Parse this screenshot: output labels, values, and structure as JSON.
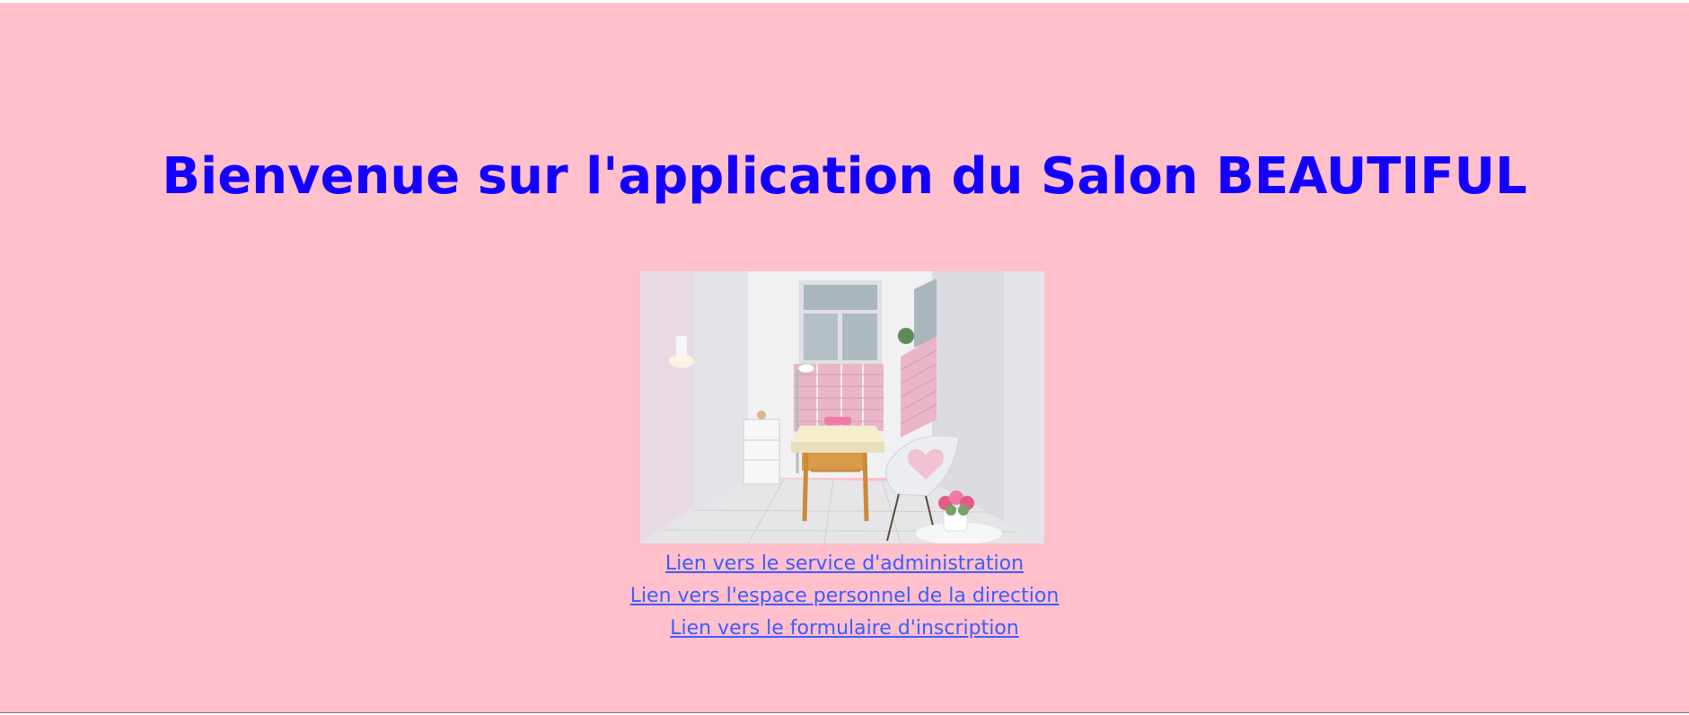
{
  "page": {
    "title": "Bienvenue sur l'application du Salon BEAUTIFUL",
    "background_color": "#ffc0cb",
    "title_color": "#1400ff",
    "link_color": "#3d5cff"
  },
  "photo": {
    "subject": "salon-treatment-room"
  },
  "links": [
    {
      "label": "Lien vers le service d'administration"
    },
    {
      "label": "Lien vers l'espace personnel de la direction"
    },
    {
      "label": "Lien vers le formulaire d'inscription"
    }
  ]
}
